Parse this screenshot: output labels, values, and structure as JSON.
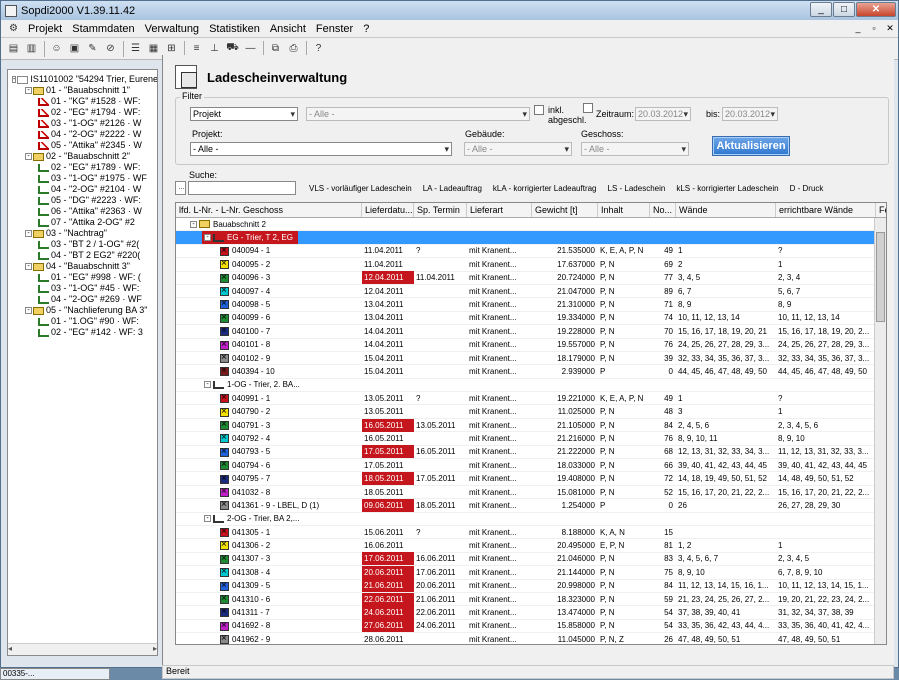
{
  "title": "Sopdi2000 V1.39.11.42",
  "menu": [
    "Projekt",
    "Stammdaten",
    "Verwaltung",
    "Statistiken",
    "Ansicht",
    "Fenster",
    "?"
  ],
  "tree": [
    {
      "depth": 0,
      "text": "IS1101002 \"54294 Trier, Eurene",
      "icon": "root",
      "exp": "-"
    },
    {
      "depth": 1,
      "text": "01 - \"Bauabschnitt 1\"",
      "icon": "bau",
      "exp": "-"
    },
    {
      "depth": 2,
      "text": "01 - \"KG\" #1528 · WF:",
      "icon": "r"
    },
    {
      "depth": 2,
      "text": "02 - \"EG\" #1794 · WF:",
      "icon": "r"
    },
    {
      "depth": 2,
      "text": "03 - \"1-OG\" #2126 · W",
      "icon": "r"
    },
    {
      "depth": 2,
      "text": "04 - \"2-OG\" #2222 · W",
      "icon": "r"
    },
    {
      "depth": 2,
      "text": "05 - \"Attika\" #2345 · W",
      "icon": "r"
    },
    {
      "depth": 1,
      "text": "02 - \"Bauabschnitt 2\"",
      "icon": "bau",
      "exp": "-"
    },
    {
      "depth": 2,
      "text": "02 - \"EG\" #1789 · WF:",
      "icon": "g"
    },
    {
      "depth": 2,
      "text": "03 - \"1-OG\" #1975 · WF",
      "icon": "g"
    },
    {
      "depth": 2,
      "text": "04 - \"2-OG\" #2104 · W",
      "icon": "g"
    },
    {
      "depth": 2,
      "text": "05 - \"DG\" #2223 · WF:",
      "icon": "g"
    },
    {
      "depth": 2,
      "text": "06 - \"Attika\" #2363 · W",
      "icon": "g"
    },
    {
      "depth": 2,
      "text": "07 - \"Attika 2-OG\" #2",
      "icon": "g"
    },
    {
      "depth": 1,
      "text": "03 - \"Nachtrag\"",
      "icon": "bau",
      "exp": "-"
    },
    {
      "depth": 2,
      "text": "03 - \"BT 2 / 1-OG\" #2(",
      "icon": "g"
    },
    {
      "depth": 2,
      "text": "04 - \"BT 2 EG2\" #220(",
      "icon": "g"
    },
    {
      "depth": 1,
      "text": "04 - \"Bauabschnitt 3\"",
      "icon": "bau",
      "exp": "-"
    },
    {
      "depth": 2,
      "text": "01 - \"EG\" #998 · WF: (",
      "icon": "g"
    },
    {
      "depth": 2,
      "text": "03 - \"1-OG\" #45 · WF:",
      "icon": "g"
    },
    {
      "depth": 2,
      "text": "04 - \"2-OG\" #269 · WF",
      "icon": "g"
    },
    {
      "depth": 1,
      "text": "05 - \"Nachlieferung BA 3\"",
      "icon": "bau",
      "exp": "-"
    },
    {
      "depth": 2,
      "text": "01 - \"1.OG\" #90 · WF:",
      "icon": "g"
    },
    {
      "depth": 2,
      "text": "02 - \"EG\" #142 · WF: 3",
      "icon": "g"
    }
  ],
  "header": {
    "title": "Ladescheinverwaltung"
  },
  "filter": {
    "label": "Filter",
    "type": "Projekt",
    "type_other": "- Alle -",
    "inkl": "inkl.",
    "abgeschl": "abgeschl.",
    "zeitraum": "Zeitraum:",
    "date_from": "20.03.2012",
    "bis": "bis:",
    "date_to": "20.03.2012",
    "projekt_label": "Projekt:",
    "projekt_value": "- Alle -",
    "gebaeude_label": "Gebäude:",
    "gebaeude_value": "- Alle -",
    "geschoss_label": "Geschoss:",
    "geschoss_value": "- Alle -",
    "aktualisieren": "Aktualisieren"
  },
  "search": {
    "label": "Suche:",
    "btn": "..."
  },
  "legend": [
    "VLS - vorläufiger Ladeschein",
    "LA - Ladeauftrag",
    "kLA - korrigierter Ladeauftrag",
    "LS - Ladeschein",
    "kLS - korrigierter Ladeschein",
    "D - Druck"
  ],
  "columns": [
    "lfd. L-Nr. - L-Nr. Geschoss",
    "Lieferdatu...",
    "Sp. Termin",
    "Lieferart",
    "Gewicht [t]",
    "Inhalt",
    "No...",
    "Wände",
    "errichtbare Wände",
    "Fehl"
  ],
  "groups": [
    {
      "label": "Bauabschnitt 2"
    },
    {
      "label": "EG - Trier, T 2, EG",
      "red": true,
      "sel": true,
      "rows": [
        [
          "040094 - 1",
          "11.04.2011",
          false,
          "?",
          "mit Kranent...",
          "21.535000",
          "K, E, A, P, N",
          "49",
          "1",
          "?",
          "red"
        ],
        [
          "040095 - 2",
          "11.04.2011",
          false,
          "",
          "mit Kranent...",
          "17.637000",
          "P, N",
          "69",
          "2",
          "1",
          "yellow"
        ],
        [
          "040096 - 3",
          "12.04.2011",
          true,
          "11.04.2011",
          "mit Kranent...",
          "20.724000",
          "P, N",
          "77",
          "3, 4, 5",
          "2, 3, 4",
          "green"
        ],
        [
          "040097 - 4",
          "12.04.2011",
          false,
          "",
          "mit Kranent...",
          "21.047000",
          "P, N",
          "89",
          "6, 7",
          "5, 6, 7",
          "cyan"
        ],
        [
          "040098 - 5",
          "13.04.2011",
          false,
          "",
          "mit Kranent...",
          "21.310000",
          "P, N",
          "71",
          "8, 9",
          "8, 9",
          "blue"
        ],
        [
          "040099 - 6",
          "13.04.2011",
          false,
          "",
          "mit Kranent...",
          "19.334000",
          "P, N",
          "74",
          "10, 11, 12, 13, 14",
          "10, 11, 12, 13, 14",
          "green"
        ],
        [
          "040100 - 7",
          "14.04.2011",
          false,
          "",
          "mit Kranent...",
          "19.228000",
          "P, N",
          "70",
          "15, 16, 17, 18, 19, 20, 21",
          "15, 16, 17, 18, 19, 20, 2...",
          "navy"
        ],
        [
          "040101 - 8",
          "14.04.2011",
          false,
          "",
          "mit Kranent...",
          "19.557000",
          "P, N",
          "76",
          "24, 25, 26, 27, 28, 29, 3...",
          "24, 25, 26, 27, 28, 29, 3...",
          "magenta"
        ],
        [
          "040102 - 9",
          "15.04.2011",
          false,
          "",
          "mit Kranent...",
          "18.179000",
          "P, N",
          "39",
          "32, 33, 34, 35, 36, 37, 3...",
          "32, 33, 34, 35, 36, 37, 3...",
          "gray"
        ],
        [
          "040394 - 10",
          "15.04.2011",
          false,
          "",
          "mit Kranent...",
          "2.939000",
          "P",
          "0",
          "44, 45, 46, 47, 48, 49, 50",
          "44, 45, 46, 47, 48, 49, 50",
          "darkred"
        ]
      ]
    },
    {
      "label": "1-OG - Trier, 2. BA...",
      "rows": [
        [
          "040991 - 1",
          "13.05.2011",
          false,
          "?",
          "mit Kranent...",
          "19.221000",
          "K, E, A, P, N",
          "49",
          "1",
          "?",
          "red"
        ],
        [
          "040790 - 2",
          "13.05.2011",
          false,
          "",
          "mit Kranent...",
          "11.025000",
          "P, N",
          "48",
          "3",
          "1",
          "yellow"
        ],
        [
          "040791 - 3",
          "16.05.2011",
          true,
          "13.05.2011",
          "mit Kranent...",
          "21.105000",
          "P, N",
          "84",
          "2, 4, 5, 6",
          "2, 3, 4, 5, 6",
          "green"
        ],
        [
          "040792 - 4",
          "16.05.2011",
          false,
          "",
          "mit Kranent...",
          "21.216000",
          "P, N",
          "76",
          "8, 9, 10, 11",
          "8, 9, 10",
          "cyan"
        ],
        [
          "040793 - 5",
          "17.05.2011",
          true,
          "16.05.2011",
          "mit Kranent...",
          "21.222000",
          "P, N",
          "68",
          "12, 13, 31, 32, 33, 34, 3...",
          "11, 12, 13, 31, 32, 33, 3...",
          "blue"
        ],
        [
          "040794 - 6",
          "17.05.2011",
          false,
          "",
          "mit Kranent...",
          "18.033000",
          "P, N",
          "66",
          "39, 40, 41, 42, 43, 44, 45",
          "39, 40, 41, 42, 43, 44, 45",
          "green"
        ],
        [
          "040795 - 7",
          "18.05.2011",
          true,
          "17.05.2011",
          "mit Kranent...",
          "19.408000",
          "P, N",
          "72",
          "14, 18, 19, 49, 50, 51, 52",
          "14, 48, 49, 50, 51, 52",
          "navy"
        ],
        [
          "041032 - 8",
          "18.05.2011",
          false,
          "",
          "mit Kranent...",
          "15.081000",
          "P, N",
          "52",
          "15, 16, 17, 20, 21, 22, 2...",
          "15, 16, 17, 20, 21, 22, 2...",
          "magenta"
        ],
        [
          "041361 - 9   - LBEL, D (1)",
          "09.06.2011",
          true,
          "18.05.2011",
          "mit Kranent...",
          "1.254000",
          "P",
          "0",
          "26",
          "26, 27, 28, 29, 30",
          "gray"
        ]
      ]
    },
    {
      "label": "2-OG - Trier, BA 2,...",
      "rows": [
        [
          "041305 - 1",
          "15.06.2011",
          false,
          "?",
          "mit Kranent...",
          "8.188000",
          "K, A, N",
          "15",
          "",
          "",
          "red"
        ],
        [
          "041306 - 2",
          "16.06.2011",
          false,
          "",
          "mit Kranent...",
          "20.495000",
          "E, P, N",
          "81",
          "1, 2",
          "1",
          "yellow"
        ],
        [
          "041307 - 3",
          "17.06.2011",
          true,
          "16.06.2011",
          "mit Kranent...",
          "21.046000",
          "P, N",
          "83",
          "3, 4, 5, 6, 7",
          "2, 3, 4, 5",
          "green"
        ],
        [
          "041308 - 4",
          "20.06.2011",
          true,
          "17.06.2011",
          "mit Kranent...",
          "21.144000",
          "P, N",
          "75",
          "8, 9, 10",
          "6, 7, 8, 9, 10",
          "cyan"
        ],
        [
          "041309 - 5",
          "21.06.2011",
          true,
          "20.06.2011",
          "mit Kranent...",
          "20.998000",
          "P, N",
          "84",
          "11, 12, 13, 14, 15, 16, 1...",
          "10, 11, 12, 13, 14, 15, 1...",
          "blue"
        ],
        [
          "041310 - 6",
          "22.06.2011",
          true,
          "21.06.2011",
          "mit Kranent...",
          "18.323000",
          "P, N",
          "59",
          "21, 23, 24, 25, 26, 27, 2...",
          "19, 20, 21, 22, 23, 24, 2...",
          "green"
        ],
        [
          "041311 - 7",
          "24.06.2011",
          true,
          "22.06.2011",
          "mit Kranent...",
          "13.474000",
          "P, N",
          "54",
          "37, 38, 39, 40, 41",
          "31, 32, 34, 37, 38, 39",
          "navy"
        ],
        [
          "041692 - 8",
          "27.06.2011",
          true,
          "24.06.2011",
          "mit Kranent...",
          "15.858000",
          "P, N",
          "54",
          "33, 35, 36, 42, 43, 44, 4...",
          "33, 35, 36, 40, 41, 42, 4...",
          "magenta"
        ],
        [
          "041962 - 9",
          "28.06.2011",
          false,
          "",
          "mit Kranent...",
          "11.045000",
          "P, N, Z",
          "26",
          "47, 48, 49, 50, 51",
          "47, 48, 49, 50, 51",
          "gray"
        ]
      ]
    }
  ],
  "status": "Bereit",
  "taskbar": "00335-..."
}
